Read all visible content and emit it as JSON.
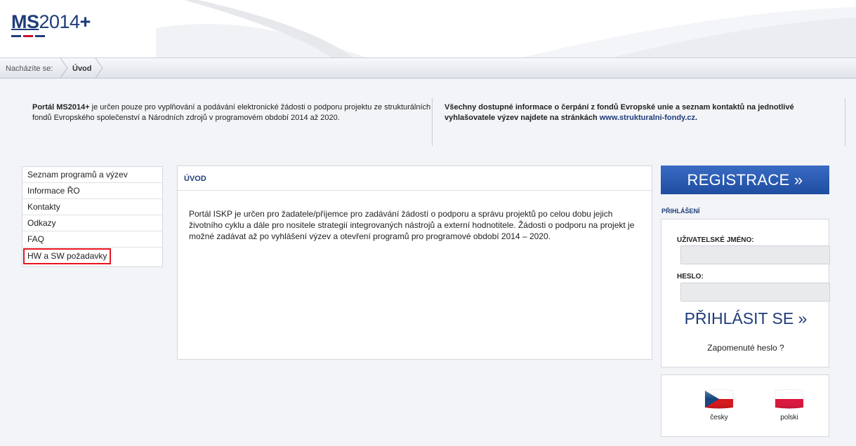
{
  "header": {
    "logo_ms": "MS",
    "logo_year": "2014",
    "logo_plus": "+"
  },
  "breadcrumb": {
    "label": "Nacházíte se:",
    "items": [
      "Úvod"
    ]
  },
  "info": {
    "left_bold": "Portál MS2014+",
    "left_text": " je určen pouze pro vyplňování a podávání elektronické žádosti o podporu projektu ze strukturálních fondů Evropského společenství a Národních zdrojů v programovém období 2014 až 2020.",
    "right_text": "Všechny dostupné informace o čerpání z fondů Evropské unie a seznam kontaktů na jednotlivé vyhlašovatele výzev najdete na stránkách ",
    "right_link": "www.strukturalni-fondy.cz",
    "right_end": "."
  },
  "menu": {
    "items": [
      {
        "label": "Seznam programů a výzev"
      },
      {
        "label": "Informace ŘO"
      },
      {
        "label": "Kontakty"
      },
      {
        "label": "Odkazy"
      },
      {
        "label": "FAQ"
      },
      {
        "label": "HW a SW požadavky"
      }
    ]
  },
  "main": {
    "title": "ÚVOD",
    "text": "Portál ISKP je určen pro žadatele/příjemce pro zadávání žádostí o podporu a správu projektů po celou dobu jejich životního cyklu a dále pro nositele strategií integrovaných nástrojů a externí hodnotitele. Žádosti o podporu na projekt je možné zadávat až po vyhlášení výzev a otevření programů pro programové období 2014 – 2020."
  },
  "auth": {
    "register_label": "REGISTRACE »",
    "login_title": "PŘIHLÁŠENÍ",
    "username_label": "UŽIVATELSKÉ JMÉNO:",
    "username_value": "",
    "password_label": "HESLO:",
    "password_value": "",
    "login_label": "PŘIHLÁSIT SE »",
    "forgot_label": "Zapomenuté heslo ?"
  },
  "languages": [
    {
      "name": "česky",
      "icon": "czech-flag-icon"
    },
    {
      "name": "polski",
      "icon": "polish-flag-icon"
    }
  ],
  "colors": {
    "brand_blue": "#1f3d7a",
    "button_blue": "#2a5bb3",
    "highlight_red": "#e8151c",
    "background": "#f3f4f7"
  }
}
